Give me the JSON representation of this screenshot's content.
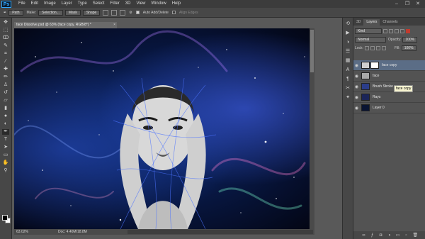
{
  "app": {
    "logo": "Ps"
  },
  "menu": [
    "File",
    "Edit",
    "Image",
    "Layer",
    "Type",
    "Select",
    "Filter",
    "3D",
    "View",
    "Window",
    "Help"
  ],
  "window_controls": {
    "minimize": "–",
    "restore": "❐",
    "close": "✕"
  },
  "options": {
    "mode": "Path",
    "make_label": "Make:",
    "selection": "Selection...",
    "mask": "Mask",
    "shape": "Shape",
    "auto_add_delete": "Auto Add/Delete",
    "align_edges": "Align Edges",
    "auto_add_checked": true,
    "align_edges_checked": false
  },
  "document": {
    "tab_title": "face Dissolve.psd @ 63% (face copy, RGB/8*) *",
    "close": "×",
    "zoom": "63.02%",
    "doc_size": "Doc: 4.40M/18.8M"
  },
  "panels": {
    "tabs": [
      "3D",
      "Layers",
      "Channels"
    ],
    "active_tab": "Layers",
    "blend_mode": "Normal",
    "opacity_label": "Opacity:",
    "opacity": "100%",
    "lock_label": "Lock:",
    "fill_label": "Fill:",
    "fill": "100%",
    "kind": "Kind"
  },
  "layers": [
    {
      "name": "face copy",
      "selected": true,
      "visible": true,
      "has_mask": true,
      "thumb": "#cfcfcf"
    },
    {
      "name": "face",
      "selected": false,
      "visible": true,
      "has_mask": false,
      "thumb": "#a8a8a8"
    },
    {
      "name": "Brush Stroke",
      "selected": false,
      "visible": true,
      "has_mask": false,
      "thumb": "#2b3d8a"
    },
    {
      "name": "Rays",
      "selected": false,
      "visible": true,
      "has_mask": false,
      "thumb": "#1b2558"
    },
    {
      "name": "Layer 0",
      "selected": false,
      "visible": true,
      "has_mask": false,
      "thumb": "#0a1432"
    }
  ],
  "tooltip": "face copy",
  "colors": {
    "accent": "#31a8ff",
    "selected_layer": "#5b6d86",
    "foreground": "#000000",
    "background": "#ffffff"
  },
  "icons": {
    "tools": [
      "move-icon",
      "marquee-icon",
      "lasso-icon",
      "quick-select-icon",
      "crop-icon",
      "eyedropper-icon",
      "healing-icon",
      "brush-icon",
      "clone-stamp-icon",
      "history-brush-icon",
      "eraser-icon",
      "gradient-icon",
      "blur-icon",
      "dodge-icon",
      "pen-icon",
      "type-icon",
      "path-select-icon",
      "rectangle-icon",
      "hand-icon",
      "zoom-icon"
    ],
    "dock": [
      "history-icon",
      "actions-icon",
      "adjustments-icon",
      "properties-icon",
      "swatches-icon",
      "character-icon",
      "paragraph-icon",
      "brushes-icon",
      "tools-preset-icon"
    ]
  }
}
